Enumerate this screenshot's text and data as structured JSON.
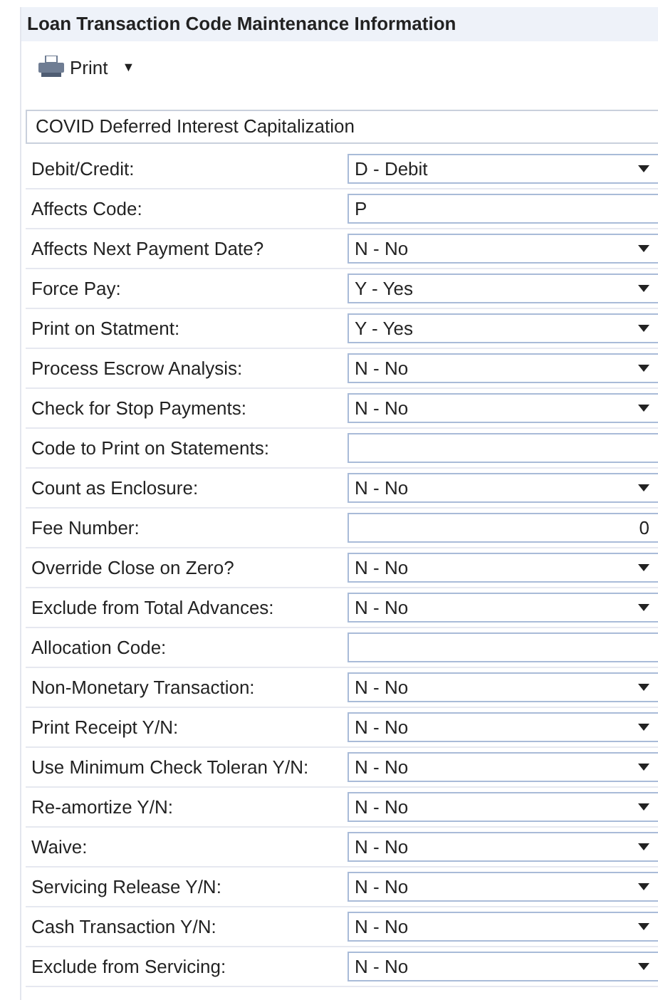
{
  "panel": {
    "title": "Loan Transaction Code Maintenance Information"
  },
  "toolbar": {
    "print_button": {
      "label": "Print",
      "caret": "▼"
    }
  },
  "description": {
    "value": "COVID Deferred Interest Capitalization"
  },
  "fields": [
    {
      "label": "Debit/Credit:",
      "kind": "select",
      "value": "D - Debit"
    },
    {
      "label": "Affects Code:",
      "kind": "text",
      "value": "P"
    },
    {
      "label": "Affects Next Payment Date?",
      "kind": "select",
      "value": "N - No"
    },
    {
      "label": "Force Pay:",
      "kind": "select",
      "value": "Y - Yes"
    },
    {
      "label": "Print on Statment:",
      "kind": "select",
      "value": "Y - Yes"
    },
    {
      "label": "Process Escrow Analysis:",
      "kind": "select",
      "value": "N - No"
    },
    {
      "label": "Check for Stop Payments:",
      "kind": "select",
      "value": "N - No"
    },
    {
      "label": "Code to Print on Statements:",
      "kind": "text"
    },
    {
      "label": "Count as Enclosure:",
      "kind": "select",
      "value": "N - No"
    },
    {
      "label": "Fee Number:",
      "kind": "number",
      "value": "0"
    },
    {
      "label": "Override Close on Zero?",
      "kind": "select",
      "value": "N - No"
    },
    {
      "label": "Exclude from Total Advances:",
      "kind": "select",
      "value": "N - No"
    },
    {
      "label": "Allocation Code:",
      "kind": "text"
    },
    {
      "label": "Non-Monetary Transaction:",
      "kind": "select",
      "value": "N - No"
    },
    {
      "label": "Print Receipt Y/N:",
      "kind": "select",
      "value": "N - No"
    },
    {
      "label": "Use Minimum Check Toleran Y/N:",
      "kind": "select",
      "value": "N - No"
    },
    {
      "label": "Re-amortize Y/N:",
      "kind": "select",
      "value": "N - No"
    },
    {
      "label": "Waive:",
      "kind": "select",
      "value": "N - No"
    },
    {
      "label": "Servicing Release Y/N:",
      "kind": "select",
      "value": "N - No"
    },
    {
      "label": "Cash Transaction Y/N:",
      "kind": "select",
      "value": "N - No"
    },
    {
      "label": "Exclude from Servicing:",
      "kind": "select",
      "value": "N - No"
    }
  ]
}
